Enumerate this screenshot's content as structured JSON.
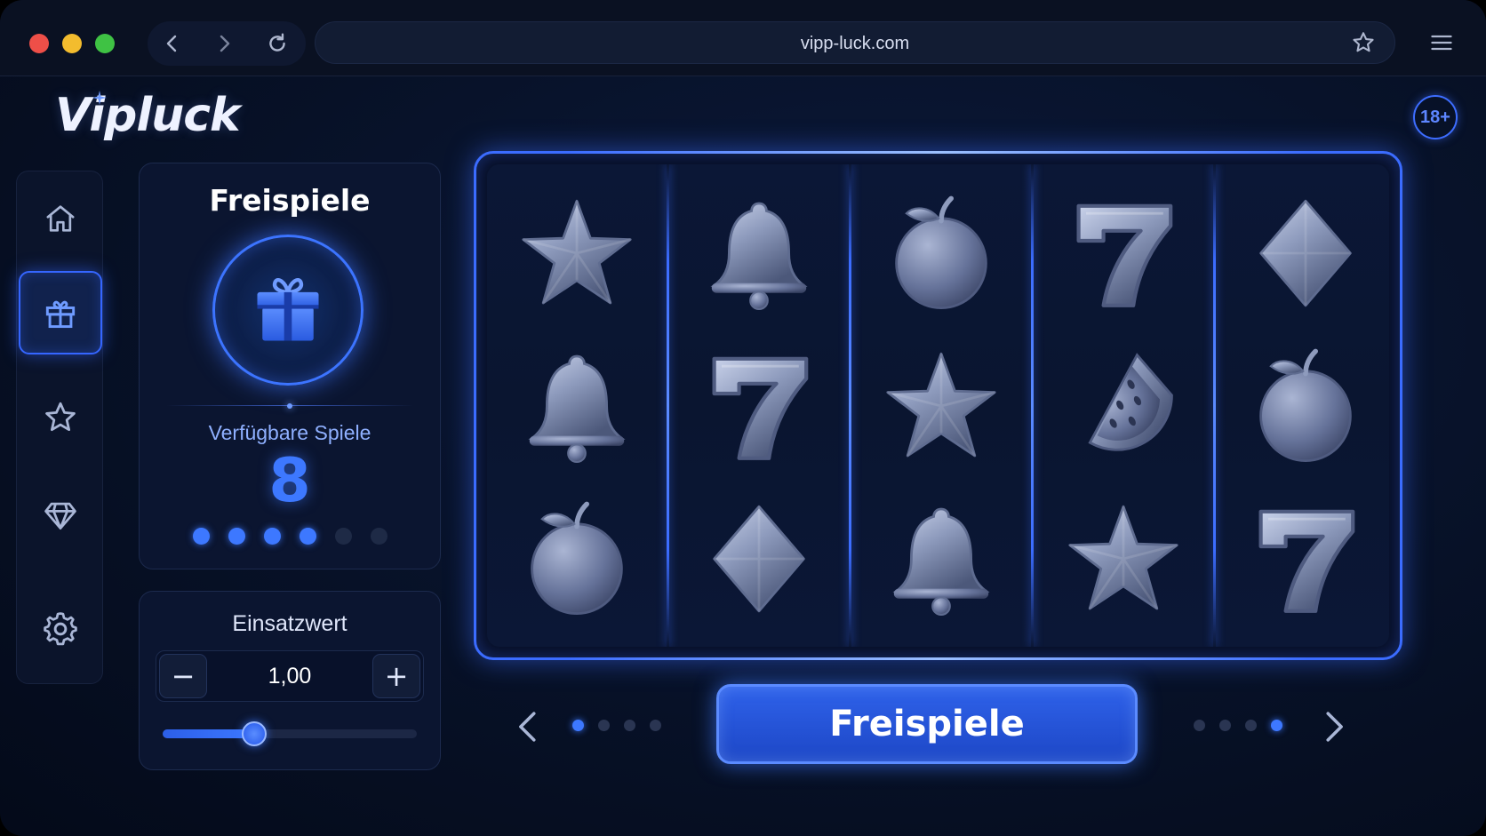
{
  "browser": {
    "url": "vipp-luck.com"
  },
  "brand": {
    "logo_text": "Vipluck",
    "age_badge": "18+"
  },
  "sidebar": {
    "items": [
      {
        "name": "home",
        "icon": "home-icon",
        "active": false
      },
      {
        "name": "gift",
        "icon": "gift-icon",
        "active": true
      },
      {
        "name": "favorites",
        "icon": "star-icon",
        "active": false
      },
      {
        "name": "vip",
        "icon": "diamond-icon",
        "active": false
      },
      {
        "name": "settings",
        "icon": "gear-icon",
        "active": false
      }
    ]
  },
  "freespins": {
    "title": "Freispiele",
    "available_label": "Verfügbare Spiele",
    "available_count": "8",
    "pips_total": 6,
    "pips_active": 4
  },
  "bet": {
    "title": "Einsatzwert",
    "minus_label": "−",
    "plus_label": "+",
    "value": "1,00",
    "slider_fraction": 0.36
  },
  "reels": [
    [
      "star",
      "bell",
      "apple"
    ],
    [
      "bell",
      "seven",
      "diamond"
    ],
    [
      "apple",
      "star",
      "bell"
    ],
    [
      "seven",
      "melon",
      "star"
    ],
    [
      "diamond",
      "apple",
      "seven"
    ]
  ],
  "controls": {
    "spin_label": "Freispiele",
    "left_dots": {
      "total": 4,
      "active": 0
    },
    "right_dots": {
      "total": 4,
      "active": 3
    }
  },
  "colors": {
    "accent": "#3d78ff",
    "background": "#071127",
    "symbol_silver": "#8e9bbd"
  }
}
